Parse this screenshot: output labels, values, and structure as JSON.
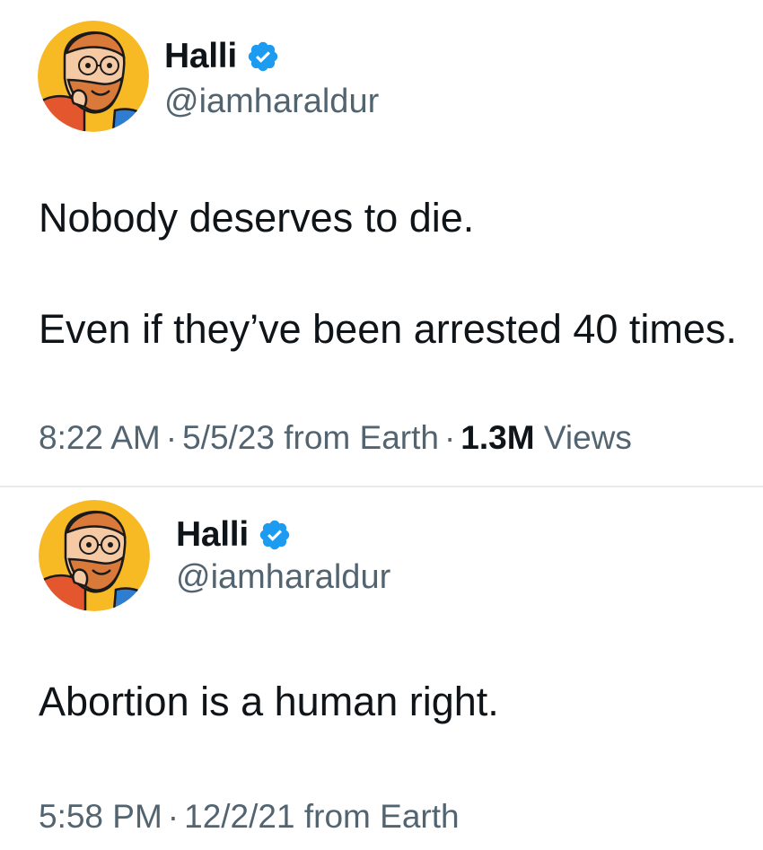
{
  "colors": {
    "text_primary": "#0f1419",
    "text_secondary": "#536471",
    "verified_blue": "#1d9bf0",
    "avatar_background": "#f7b924",
    "divider": "#e7e9ea"
  },
  "tweets": [
    {
      "display_name": "Halli",
      "handle": "@iamharaldur",
      "verified_icon": "verified-badge-icon",
      "avatar_icon": "cartoon-bearded-man-avatar",
      "body_lines": [
        "Nobody deserves to die.",
        "Even if they’ve been arrested 40 times."
      ],
      "time": "8:22 AM",
      "date": "5/5/23",
      "source": "from Earth",
      "separator": "·",
      "views_count": "1.3M",
      "views_label": "Views"
    },
    {
      "display_name": "Halli",
      "handle": "@iamharaldur",
      "verified_icon": "verified-badge-icon",
      "avatar_icon": "cartoon-bearded-man-avatar",
      "body_lines": [
        "Abortion is a human right."
      ],
      "time": "5:58 PM",
      "date": "12/2/21",
      "source": "from Earth",
      "separator": "·"
    }
  ]
}
